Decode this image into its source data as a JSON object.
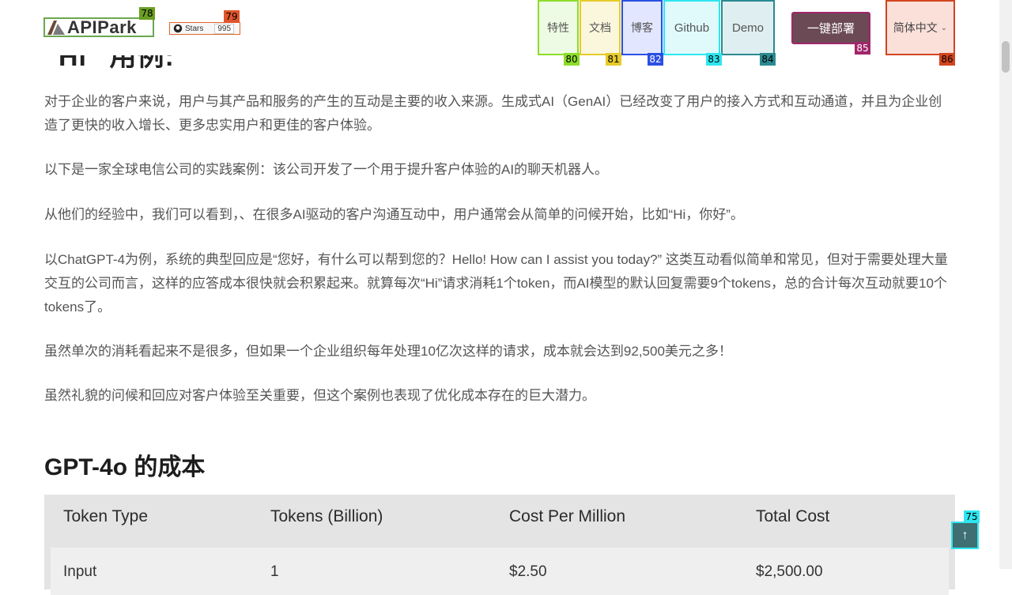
{
  "article": {
    "partial_heading": "“Hi” 用例:",
    "paragraphs": [
      "对于企业的客户来说，用户与其产品和服务的产生的互动是主要的收入来源。生成式AI（GenAI）已经改变了用户的接入方式和互动通道，并且为企业创造了更快的收入增长、更多忠实用户和更佳的客户体验。",
      "以下是一家全球电信公司的实践案例：该公司开发了一个用于提升客户体验的AI的聊天机器人。",
      "从他们的经验中，我们可以看到，、在很多AI驱动的客户沟通互动中，用户通常会从简单的问候开始，比如“Hi，你好”。",
      "以ChatGPT-4为例，系统的典型回应是“您好，有什么可以帮到您的？Hello! How can I assist you today?” 这类互动看似简单和常见，但对于需要处理大量交互的公司而言，这样的应答成本很快就会积累起来。就算每次“Hi”请求消耗1个token，而AI模型的默认回复需要9个tokens，总的合计每次互动就要10个tokens了。",
      "虽然单次的消耗看起来不是很多，但如果一个企业组织每年处理10亿次这样的请求，成本就会达到92,500美元之多！",
      "虽然礼貌的问候和回应对客户体验至关重要，但这个案例也表现了优化成本存在的巨大潜力。"
    ],
    "section_title": "GPT-4o 的成本",
    "table": {
      "headers": [
        "Token Type",
        "Tokens (Billion)",
        "Cost Per Million",
        "Total Cost"
      ],
      "first_row": [
        "Input",
        "1",
        "$2.50",
        "$2,500.00"
      ]
    }
  },
  "header": {
    "logo_text": "APIPark",
    "stars_label": "Stars",
    "stars_count": "995",
    "nav": [
      "特性",
      "文档",
      "博客",
      "Github",
      "Demo"
    ],
    "deploy_label": "一键部署",
    "lang_label": "简体中文",
    "lang_chevron": "⌄"
  },
  "tags": [
    "78",
    "79",
    "80",
    "81",
    "82",
    "83",
    "84",
    "85",
    "86",
    "75"
  ],
  "scroll_top_icon": "↑",
  "colors": {
    "deploy_bg": "#6b4a55",
    "scroll_top_bg": "#3f6f73"
  }
}
